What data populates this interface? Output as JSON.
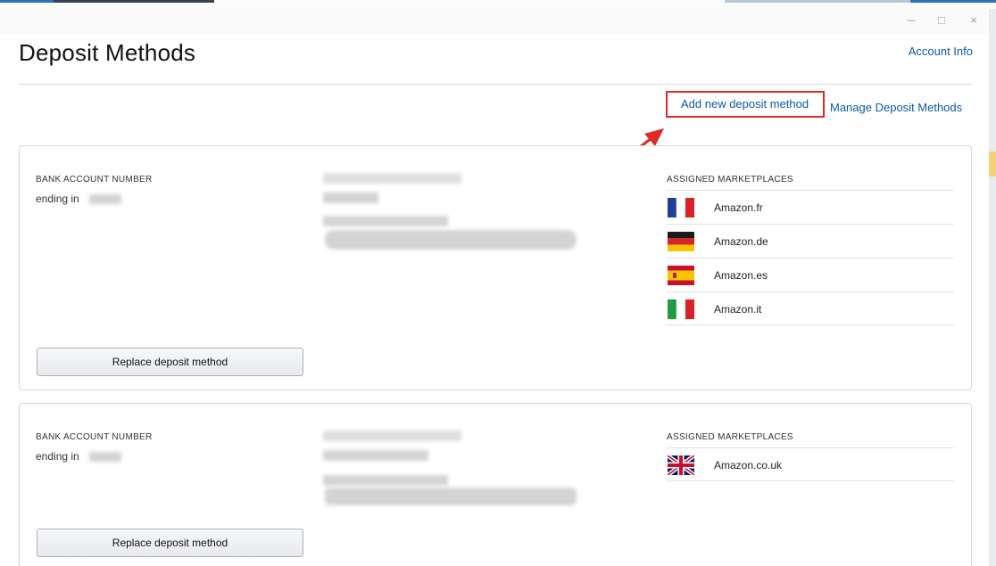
{
  "window": {
    "minimize_glyph": "─",
    "maximize_glyph": "□",
    "close_glyph": "×"
  },
  "header": {
    "title": "Deposit Methods",
    "account_link": "Account Info"
  },
  "actions": {
    "add_link": "Add new deposit method",
    "manage_link": "Manage Deposit Methods"
  },
  "accounts": [
    {
      "bank_label": "BANK ACCOUNT NUMBER",
      "ending_text": "ending in",
      "marketplaces_label": "ASSIGNED MARKETPLACES",
      "marketplaces": [
        {
          "name": "Amazon.fr",
          "flag": "france-flag-icon"
        },
        {
          "name": "Amazon.de",
          "flag": "germany-flag-icon"
        },
        {
          "name": "Amazon.es",
          "flag": "spain-flag-icon"
        },
        {
          "name": "Amazon.it",
          "flag": "italy-flag-icon"
        }
      ],
      "replace_label": "Replace deposit method"
    },
    {
      "bank_label": "BANK ACCOUNT NUMBER",
      "ending_text": "ending in",
      "marketplaces_label": "ASSIGNED MARKETPLACES",
      "marketplaces": [
        {
          "name": "Amazon.co.uk",
          "flag": "uk-flag-icon"
        }
      ],
      "replace_label": "Replace deposit method"
    }
  ],
  "colors": {
    "link": "#0b5aa7",
    "highlight": "#e02a24",
    "card_border": "#d5d9d9"
  }
}
